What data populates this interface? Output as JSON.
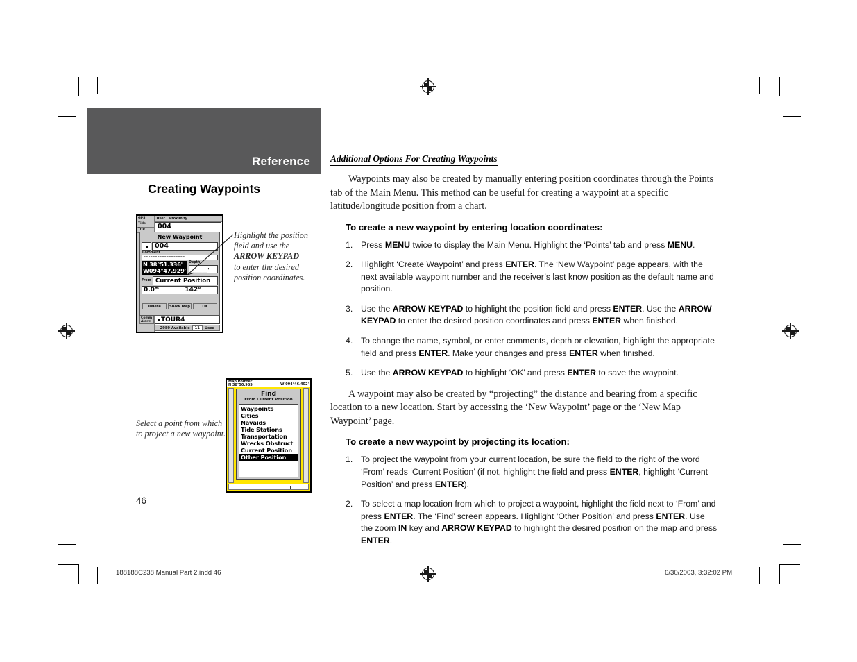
{
  "header": {
    "band_title": "Reference",
    "band_color": "#59595a",
    "section_title": "Creating Waypoints"
  },
  "page": {
    "number": "46",
    "footer_left": "188188C238 Manual Part 2.indd   46",
    "footer_right": "6/30/2003, 3:32:02 PM"
  },
  "figure1": {
    "tabs_left": [
      "GPS",
      "Tide",
      "Trip"
    ],
    "top_tabs": [
      "User",
      "Proximity"
    ],
    "waypoint_field": "004",
    "panel_title": "New Waypoint",
    "name_value": "004",
    "comment_label": "Comment",
    "comment_value": "------------------",
    "position_lat": "N 38°51.336'",
    "position_lon": "W094°47.929'",
    "depth_label": "Depth",
    "depth_value": "______'",
    "from_label": "From",
    "from_value": "Current Position",
    "distance_value": "0.0ᵐ",
    "bearing_value": "142°",
    "buttons": [
      "Delete",
      "Show Map",
      "OK"
    ],
    "bottom_tabs": [
      "Comm",
      "Alarm"
    ],
    "route_value": "TOUR4",
    "status_available": "2989 Available",
    "status_count": "11",
    "status_used": "Used"
  },
  "callout1": {
    "line1": "Highlight the position",
    "line2": "field and use the",
    "line3_bold": "ARROW KEYPAD",
    "line4": "to enter the desired",
    "line5": "position coordinates."
  },
  "callout2": {
    "line1": "Select a point from which",
    "line2": "to project a new waypoint."
  },
  "figure2": {
    "map_header_line1": "Map Pointer",
    "map_header_line2": "N 38°50.985'",
    "map_header_right": "W 094°46.402'",
    "find_title": "Find",
    "find_subtitle": "From Current Position",
    "find_items": [
      {
        "label": "Waypoints",
        "selected": false
      },
      {
        "label": "Cities",
        "selected": false
      },
      {
        "label": "Navaids",
        "selected": false
      },
      {
        "label": "Tide Stations",
        "selected": false
      },
      {
        "label": "Transportation",
        "selected": false
      },
      {
        "label": "Wrecks Obstruct",
        "selected": false
      },
      {
        "label": "Current Position",
        "selected": false
      },
      {
        "label": "Other Position",
        "selected": true
      }
    ]
  },
  "content": {
    "subhead": "Additional Options For Creating Waypoints",
    "intro_paragraph": "Waypoints may also be created by manually entering position coordinates through the Points tab of the Main Menu. This method can be useful for creating a waypoint at a specific latitude/longitude position from a chart.",
    "steps_head_1": "To create a new waypoint by entering location coordinates:",
    "steps_1": [
      {
        "num": "1.",
        "parts": [
          {
            "t": "Press ",
            "b": false
          },
          {
            "t": "MENU",
            "b": true
          },
          {
            "t": " twice to display the Main Menu. Highlight the ‘Points’ tab and press ",
            "b": false
          },
          {
            "t": "MENU",
            "b": true
          },
          {
            "t": ".",
            "b": false
          }
        ]
      },
      {
        "num": "2.",
        "parts": [
          {
            "t": "Highlight ‘Create Waypoint’ and press ",
            "b": false
          },
          {
            "t": "ENTER",
            "b": true
          },
          {
            "t": ". The ‘New Waypoint’ page appears, with the next available waypoint number and the receiver’s last know position as the default name and position.",
            "b": false
          }
        ]
      },
      {
        "num": "3.",
        "parts": [
          {
            "t": "Use the ",
            "b": false
          },
          {
            "t": "ARROW KEYPAD",
            "b": true
          },
          {
            "t": " to highlight the position field and press ",
            "b": false
          },
          {
            "t": "ENTER",
            "b": true
          },
          {
            "t": ". Use the ",
            "b": false
          },
          {
            "t": "ARROW KEYPAD",
            "b": true
          },
          {
            "t": " to enter the desired position coordinates and press ",
            "b": false
          },
          {
            "t": "ENTER",
            "b": true
          },
          {
            "t": " when finished.",
            "b": false
          }
        ]
      },
      {
        "num": "4.",
        "parts": [
          {
            "t": "To change the name, symbol, or enter comments, depth or elevation, highlight the appropriate field and press ",
            "b": false
          },
          {
            "t": "ENTER",
            "b": true
          },
          {
            "t": ". Make your changes and press ",
            "b": false
          },
          {
            "t": "ENTER",
            "b": true
          },
          {
            "t": " when finished.",
            "b": false
          }
        ]
      },
      {
        "num": "5.",
        "parts": [
          {
            "t": "Use the ",
            "b": false
          },
          {
            "t": "ARROW KEYPAD",
            "b": true
          },
          {
            "t": " to highlight ‘OK’ and press ",
            "b": false
          },
          {
            "t": "ENTER",
            "b": true
          },
          {
            "t": " to save the waypoint.",
            "b": false
          }
        ]
      }
    ],
    "mid_paragraph": "A waypoint may also be created by “projecting” the distance and bearing from a specific location to a new location. Start by accessing the ‘New Waypoint’ page or the ‘New Map Waypoint’ page.",
    "steps_head_2": "To create a new waypoint by projecting its location:",
    "steps_2": [
      {
        "num": "1.",
        "parts": [
          {
            "t": "To project the waypoint from your current location, be sure the field to the right of the word ‘From’ reads ‘Current Position’ (if not, highlight the field and press ",
            "b": false
          },
          {
            "t": "ENTER",
            "b": true
          },
          {
            "t": ", highlight ‘Current Position’ and press ",
            "b": false
          },
          {
            "t": "ENTER",
            "b": true
          },
          {
            "t": ").",
            "b": false
          }
        ]
      },
      {
        "num": "2.",
        "parts": [
          {
            "t": "To select a map location from which to project a waypoint, highlight the field next to ‘From’ and press ",
            "b": false
          },
          {
            "t": "ENTER",
            "b": true
          },
          {
            "t": ". The ‘Find’ screen appears. Highlight ‘Other Position’ and press ",
            "b": false
          },
          {
            "t": "ENTER",
            "b": true
          },
          {
            "t": ". Use the zoom ",
            "b": false
          },
          {
            "t": "IN",
            "b": true
          },
          {
            "t": " key and ",
            "b": false
          },
          {
            "t": "ARROW KEYPAD",
            "b": true
          },
          {
            "t": " to highlight the desired position on the map and press ",
            "b": false
          },
          {
            "t": "ENTER",
            "b": true
          },
          {
            "t": ".",
            "b": false
          }
        ]
      }
    ]
  }
}
